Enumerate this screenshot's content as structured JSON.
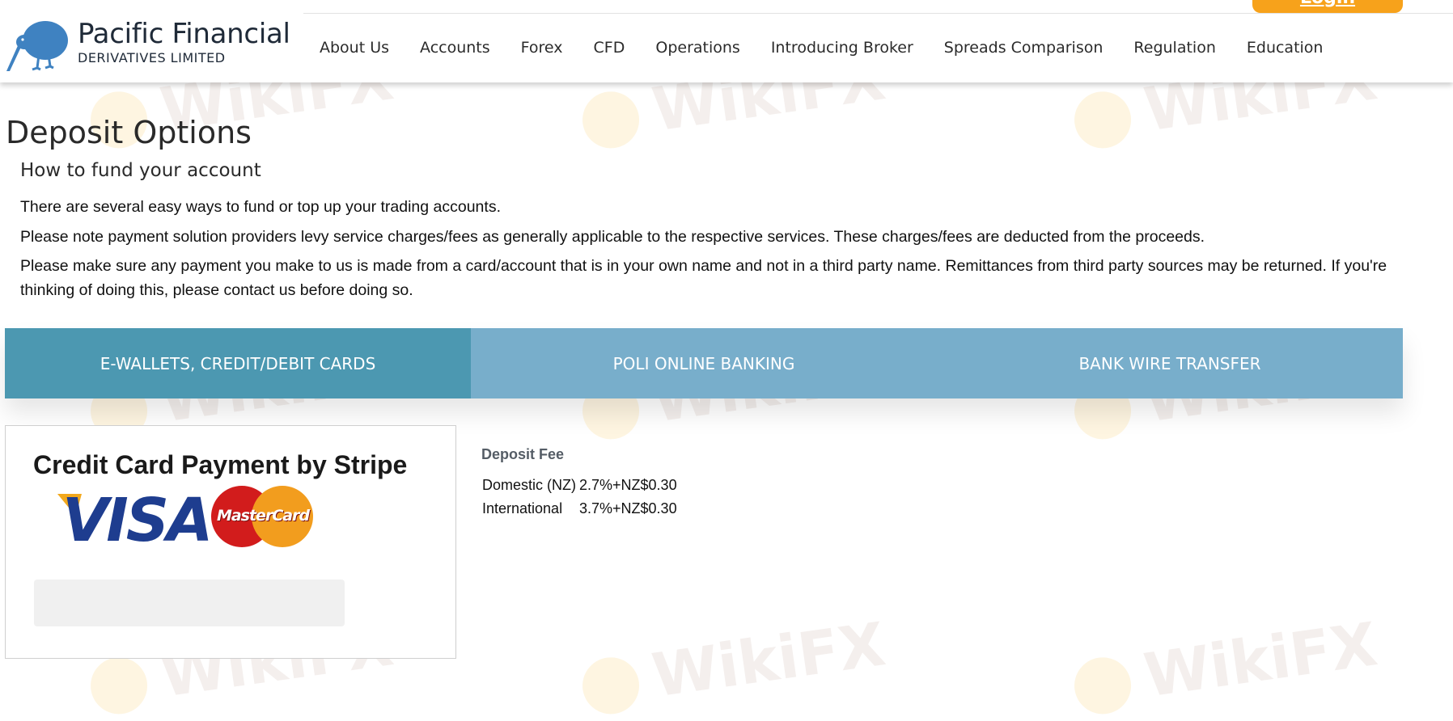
{
  "header": {
    "brand_name": "Pacific Financial",
    "brand_sub": "DERIVATIVES LIMITED",
    "login_label": "Login",
    "nav": [
      {
        "label": "About Us"
      },
      {
        "label": "Accounts"
      },
      {
        "label": "Forex"
      },
      {
        "label": "CFD"
      },
      {
        "label": "Operations"
      },
      {
        "label": "Introducing Broker"
      },
      {
        "label": "Spreads Comparison"
      },
      {
        "label": "Regulation"
      },
      {
        "label": "Education"
      }
    ]
  },
  "watermark": "WikiFX",
  "page": {
    "title": "Deposit Options",
    "subtitle": "How to fund your account",
    "paragraphs": [
      "There are several easy ways to fund or top up your trading accounts.",
      "Please note payment solution providers levy service charges/fees as generally applicable to the respective services. These charges/fees are deducted from the proceeds.",
      "Please make sure any payment you make to us is made from a card/account that is in your own name and not in a third party name. Remittances from third party sources may be returned. If you're thinking of doing this, please contact us before doing so."
    ]
  },
  "tabs": [
    {
      "label": "E-WALLETS, CREDIT/DEBIT CARDS",
      "active": true
    },
    {
      "label": "POLI ONLINE BANKING",
      "active": false
    },
    {
      "label": "BANK WIRE TRANSFER",
      "active": false
    }
  ],
  "card_panel": {
    "title": "Credit Card Payment by Stripe",
    "visa_text": "VISA",
    "mastercard_text": "MasterCard"
  },
  "fees": {
    "heading": "Deposit Fee",
    "rows": [
      {
        "region": "Domestic (NZ)",
        "fee": "2.7%+NZ$0.30"
      },
      {
        "region": "International",
        "fee": "3.7%+NZ$0.30"
      }
    ]
  },
  "colors": {
    "accent_orange": "#f7a21b",
    "tab_active": "#4c98b1",
    "tab_inactive": "#78aecb",
    "brand_text": "#1f2a38"
  }
}
